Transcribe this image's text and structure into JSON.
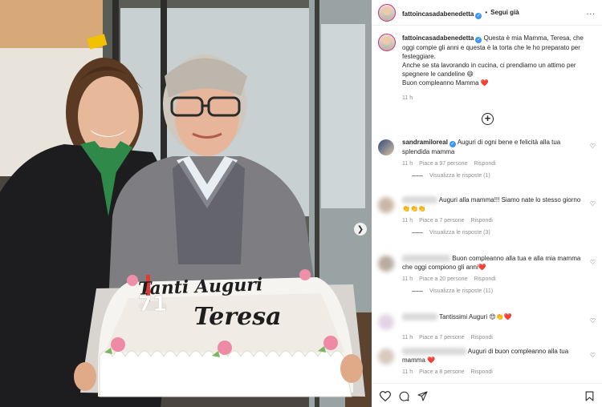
{
  "post": {
    "cake_line1": "Tanti Auguri",
    "cake_line2": "Teresa",
    "candle_number": "71"
  },
  "header": {
    "username": "fattoincasadabenedetta",
    "separator": "•",
    "follow_label": "Segui già",
    "more_label": "..."
  },
  "caption": {
    "username": "fattoincasadabenedetta",
    "text": " Questa è mia Mamma, Teresa, che oggi compie gli anni e questa è la torta che le ho preparato per festeggiare.",
    "text2": "Anche se sta lavorando in cucina, ci prendiamo un attimo per spegnere le candeline 😄",
    "text3": "Buon compleanno Mamma ❤️",
    "time": "11 h"
  },
  "comments": [
    {
      "username": "sandramiloreal",
      "text": " Auguri di ogni bene e felicità alla tua splendida mamma",
      "time": "11 h",
      "likes": "Piace a 97 persone",
      "reply": "Rispondi",
      "view_replies": "Visualizza le risposte (1)"
    },
    {
      "text": "Auguri alla mamma!!! Siamo nate lo stesso giorno 👏👏👏",
      "time": "11 h",
      "likes": "Piace a 7 persone",
      "reply": "Rispondi",
      "view_replies": "Visualizza le risposte (3)"
    },
    {
      "text": "Buon compleanno alla tua e alla mia mamma che oggi compiono gli anni❤️",
      "time": "11 h",
      "likes": "Piace a 20 persone",
      "reply": "Rispondi",
      "view_replies": "Visualizza le risposte (11)"
    },
    {
      "text": "Tantissimi Auguri 😍👏❤️",
      "time": "11 h",
      "likes": "Piace a 7 persone",
      "reply": "Rispondi"
    },
    {
      "text": "Auguri di buon compleanno alla tua mamma ❤️",
      "time": "11 h",
      "likes": "Piace a 8 persone",
      "reply": "Rispondi"
    }
  ],
  "colors": {
    "verified": "#3897f0",
    "heart": "#ed4956",
    "story_ring": "#d62976"
  }
}
